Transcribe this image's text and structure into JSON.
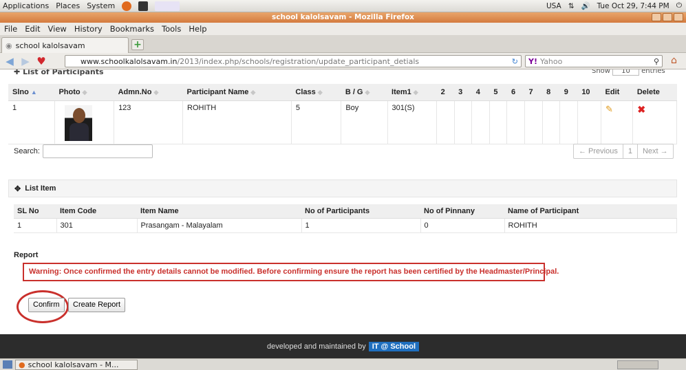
{
  "panel": {
    "menus": [
      "Applications",
      "Places",
      "System"
    ],
    "locale": "USA",
    "clock": "Tue Oct 29,  7:44 PM",
    "colors": {
      "accent": "#c9302c"
    }
  },
  "window": {
    "title": "school kalolsavam - Mozilla Firefox"
  },
  "menubar": [
    "File",
    "Edit",
    "View",
    "History",
    "Bookmarks",
    "Tools",
    "Help"
  ],
  "tab": {
    "label": "school kalolsavam"
  },
  "nav": {
    "url_domain": "www.schoolkalolsavam.in",
    "url_path": "/2013/index.php/schools/registration/update_participant_detials",
    "search_engine": "Yahoo"
  },
  "participants": {
    "section_title": "List of Participants",
    "show_label": "Show",
    "show_value": "10",
    "entries_label": "entries",
    "headers": [
      "Slno",
      "Photo",
      "Admn.No",
      "Participant Name",
      "Class",
      "B / G",
      "Item1",
      "2",
      "3",
      "4",
      "5",
      "6",
      "7",
      "8",
      "9",
      "10",
      "Edit",
      "Delete"
    ],
    "rows": [
      {
        "slno": "1",
        "admn": "123",
        "name": "ROHITH",
        "class": "5",
        "gender": "Boy",
        "item1": "301(S)"
      }
    ],
    "search_label": "Search:",
    "pager": {
      "prev": "← Previous",
      "page": "1",
      "next": "Next →"
    }
  },
  "list_item": {
    "title": "List Item",
    "headers": [
      "SL No",
      "Item Code",
      "Item Name",
      "No of Participants",
      "No of Pinnany",
      "Name of Participant"
    ],
    "rows": [
      {
        "sl": "1",
        "code": "301",
        "item": "Prasangam - Malayalam",
        "count": "1",
        "pinnany": "0",
        "participant": "ROHITH"
      }
    ]
  },
  "report": {
    "label": "Report",
    "warning": "Warning: Once confirmed the entry details cannot be modified. Before confirming ensure the report has been certified by the Headmaster/Principal.",
    "confirm": "Confirm",
    "create": "Create Report"
  },
  "footer": {
    "text": "developed and maintained by",
    "logo": "IT @ School"
  },
  "taskbar": {
    "item": "school kalolsavam - M..."
  }
}
